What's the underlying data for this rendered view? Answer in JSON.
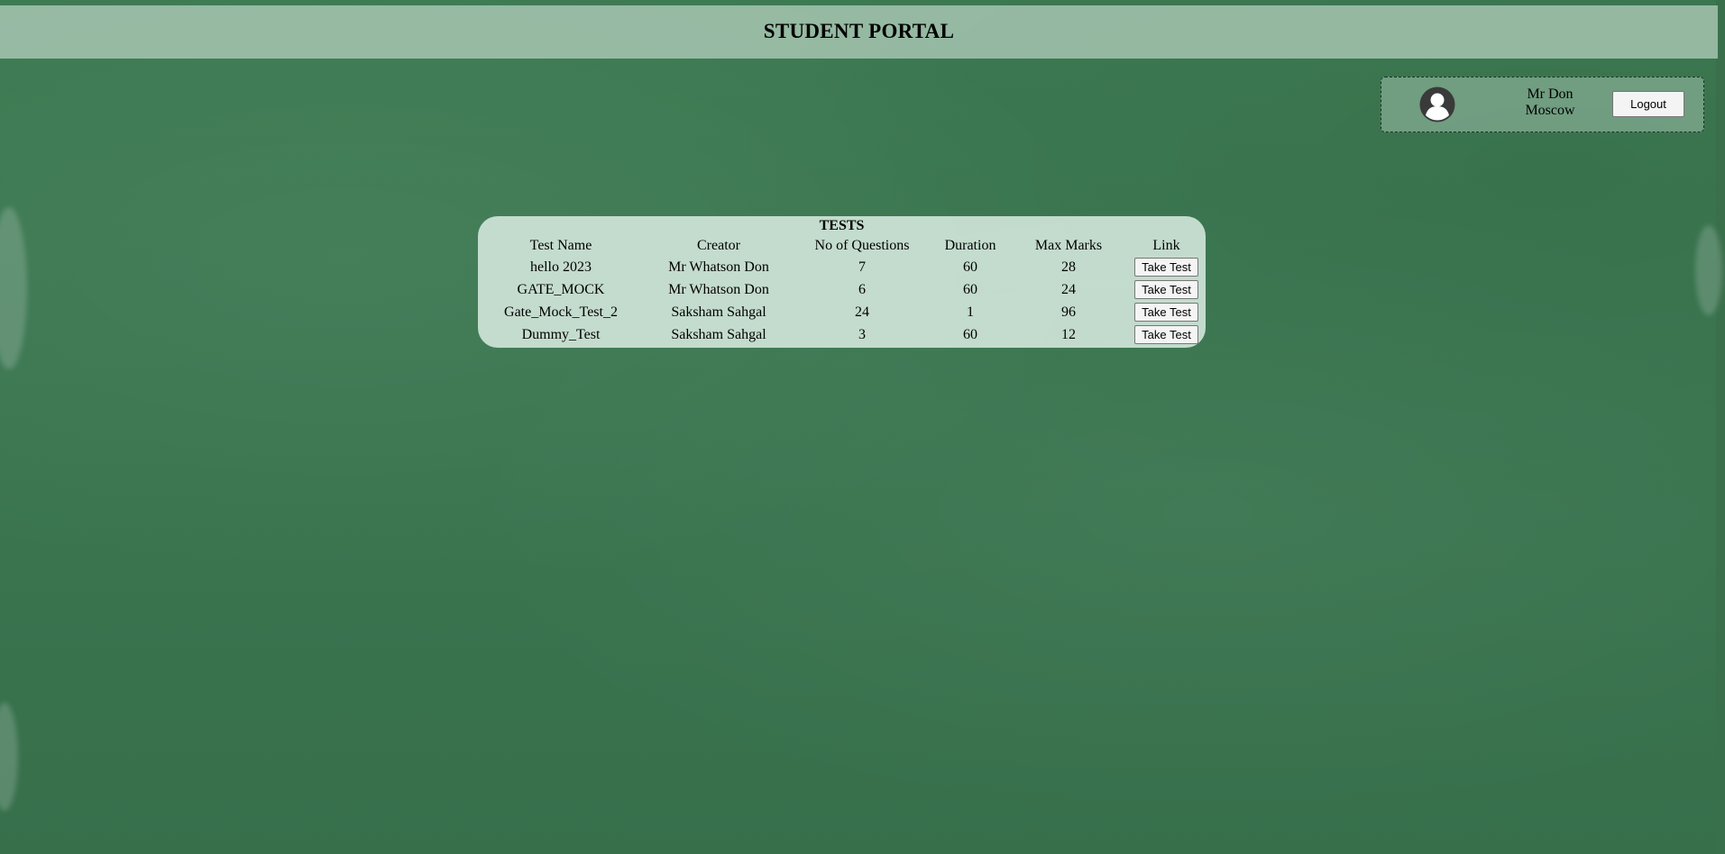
{
  "header": {
    "title": "STUDENT PORTAL"
  },
  "user": {
    "name": "Mr Don",
    "city": "Moscow",
    "avatar_icon": "user-avatar-icon",
    "logout_label": "Logout"
  },
  "tests": {
    "title": "TESTS",
    "columns": [
      "Test Name",
      "Creator",
      "No of Questions",
      "Duration",
      "Max Marks",
      "Link"
    ],
    "rows": [
      {
        "name": "hello 2023",
        "creator": "Mr Whatson Don",
        "questions": "7",
        "duration": "60",
        "max_marks": "28",
        "link_label": "Take Test"
      },
      {
        "name": "GATE_MOCK",
        "creator": "Mr Whatson Don",
        "questions": "6",
        "duration": "60",
        "max_marks": "24",
        "link_label": "Take Test"
      },
      {
        "name": "Gate_Mock_Test_2",
        "creator": "Saksham Sahgal",
        "questions": "24",
        "duration": "1",
        "max_marks": "96",
        "link_label": "Take Test"
      },
      {
        "name": "Dummy_Test",
        "creator": "Saksham Sahgal",
        "questions": "3",
        "duration": "60",
        "max_marks": "12",
        "link_label": "Take Test"
      }
    ]
  },
  "colors": {
    "background": "#3a7650",
    "header_bg": "#cde1d4",
    "panel_bg": "#d6e9de"
  }
}
